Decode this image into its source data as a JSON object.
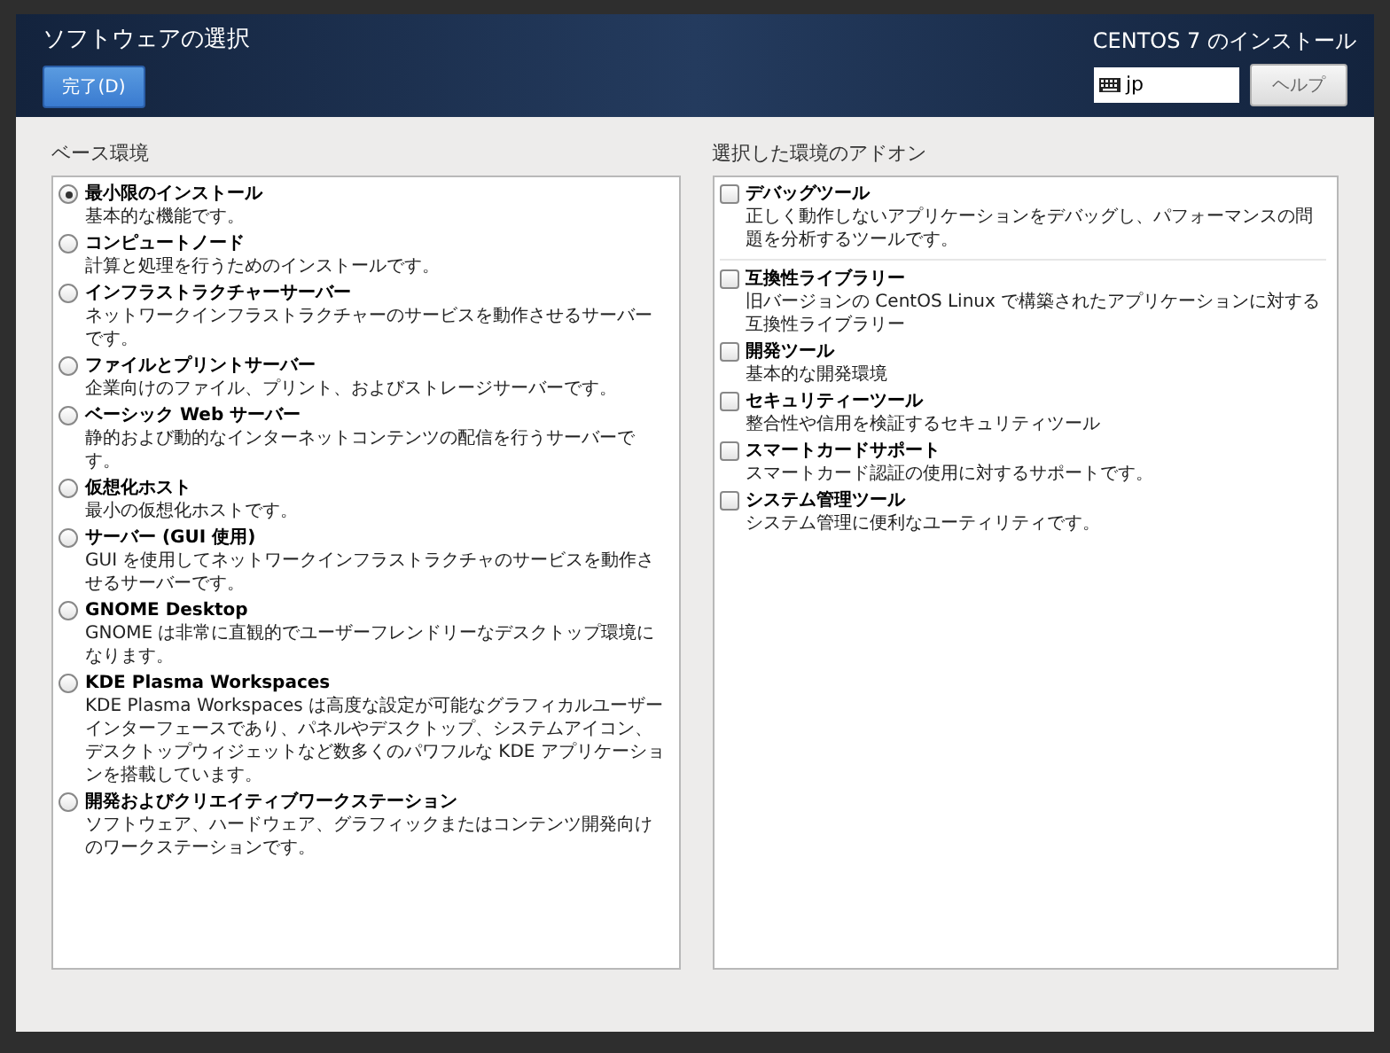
{
  "header": {
    "title": "ソフトウェアの選択",
    "done_button": "完了(D)",
    "product": "CENTOS 7 のインストール",
    "keyboard_layout": "jp",
    "help_button": "ヘルプ"
  },
  "base_environment": {
    "heading": "ベース環境",
    "items": [
      {
        "name": "最小限のインストール",
        "description": "基本的な機能です。",
        "selected": true
      },
      {
        "name": "コンピュートノード",
        "description": "計算と処理を行うためのインストールです。",
        "selected": false
      },
      {
        "name": "インフラストラクチャーサーバー",
        "description": "ネットワークインフラストラクチャーのサービスを動作させるサーバーです。",
        "selected": false
      },
      {
        "name": "ファイルとプリントサーバー",
        "description": "企業向けのファイル、プリント、およびストレージサーバーです。",
        "selected": false
      },
      {
        "name": "ベーシック Web サーバー",
        "description": "静的および動的なインターネットコンテンツの配信を行うサーバーです。",
        "selected": false
      },
      {
        "name": "仮想化ホスト",
        "description": "最小の仮想化ホストです。",
        "selected": false
      },
      {
        "name": "サーバー (GUI 使用)",
        "description": "GUI を使用してネットワークインフラストラクチャのサービスを動作させるサーバーです。",
        "selected": false
      },
      {
        "name": "GNOME Desktop",
        "description": "GNOME は非常に直観的でユーザーフレンドリーなデスクトップ環境になります。",
        "selected": false
      },
      {
        "name": "KDE Plasma Workspaces",
        "description": "KDE Plasma Workspaces は高度な設定が可能なグラフィカルユーザーインターフェースであり、パネルやデスクトップ、システムアイコン、デスクトップウィジェットなど数多くのパワフルな KDE アプリケーションを搭載しています。",
        "selected": false
      },
      {
        "name": "開発およびクリエイティブワークステーション",
        "description": "ソフトウェア、ハードウェア、グラフィックまたはコンテンツ開発向けのワークステーションです。",
        "selected": false
      }
    ]
  },
  "addons": {
    "heading": "選択した環境のアドオン",
    "items": [
      {
        "name": "デバッグツール",
        "description": "正しく動作しないアプリケーションをデバッグし、パフォーマンスの問題を分析するツールです。",
        "checked": false
      },
      {
        "name": "互換性ライブラリー",
        "description": "旧バージョンの CentOS Linux で構築されたアプリケーションに対する互換性ライブラリー",
        "checked": false
      },
      {
        "name": "開発ツール",
        "description": "基本的な開発環境",
        "checked": false
      },
      {
        "name": "セキュリティーツール",
        "description": "整合性や信用を検証するセキュリティツール",
        "checked": false
      },
      {
        "name": "スマートカードサポート",
        "description": "スマートカード認証の使用に対するサポートです。",
        "checked": false
      },
      {
        "name": "システム管理ツール",
        "description": "システム管理に便利なユーティリティです。",
        "checked": false
      }
    ]
  }
}
